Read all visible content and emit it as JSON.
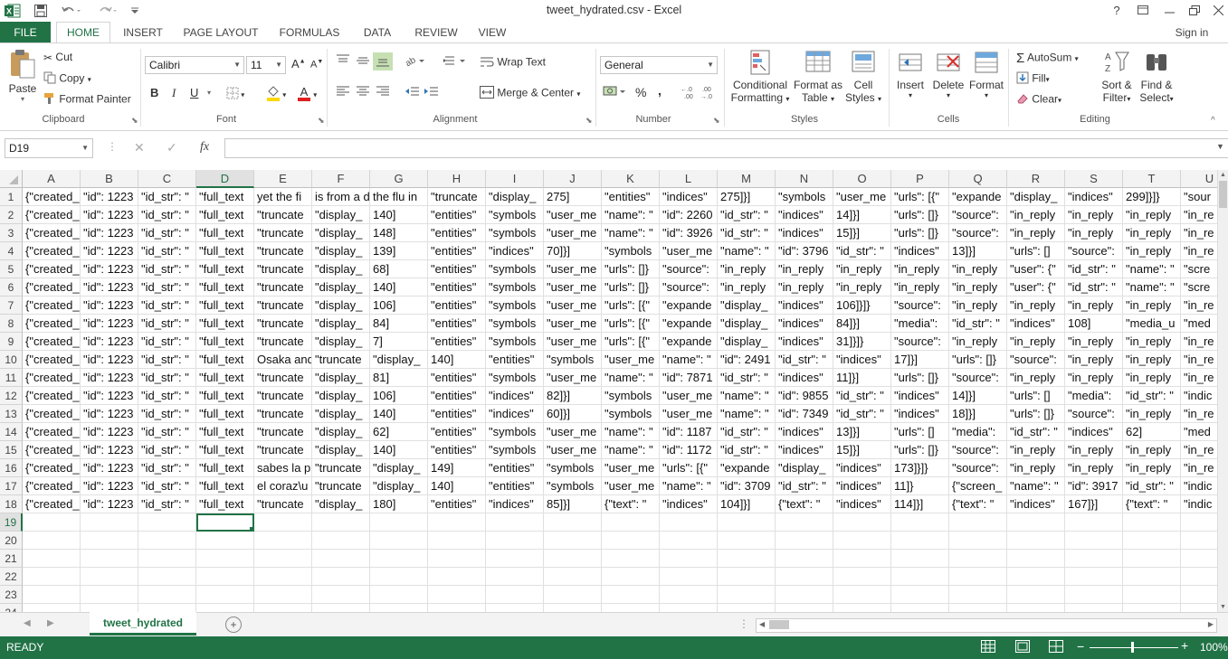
{
  "window": {
    "title": "tweet_hydrated.csv - Excel",
    "help": "?",
    "signin": "Sign in"
  },
  "tabs": [
    "FILE",
    "HOME",
    "INSERT",
    "PAGE LAYOUT",
    "FORMULAS",
    "DATA",
    "REVIEW",
    "VIEW"
  ],
  "active_tab": "HOME",
  "ribbon": {
    "clipboard": {
      "label": "Clipboard",
      "paste": "Paste",
      "cut": "Cut",
      "copy": "Copy",
      "format_painter": "Format Painter"
    },
    "font": {
      "label": "Font",
      "family": "Calibri",
      "size": "11",
      "bold": "B",
      "italic": "I",
      "underline": "U",
      "grow": "A",
      "shrink": "A"
    },
    "alignment": {
      "label": "Alignment",
      "wrap": "Wrap Text",
      "merge": "Merge & Center"
    },
    "number": {
      "label": "Number",
      "format": "General",
      "percent": "%",
      "comma": ","
    },
    "styles": {
      "label": "Styles",
      "conditional": [
        "Conditional",
        "Formatting"
      ],
      "format_table": [
        "Format as",
        "Table"
      ],
      "cell_styles": [
        "Cell",
        "Styles"
      ]
    },
    "cells": {
      "label": "Cells",
      "insert": "Insert",
      "delete": "Delete",
      "format": "Format"
    },
    "editing": {
      "label": "Editing",
      "autosum": "AutoSum",
      "fill": "Fill",
      "clear": "Clear",
      "sort": [
        "Sort &",
        "Filter"
      ],
      "find": [
        "Find &",
        "Select"
      ]
    }
  },
  "formula_bar": {
    "name_box": "D19",
    "fx": "fx",
    "value": ""
  },
  "columns": [
    "A",
    "B",
    "C",
    "D",
    "E",
    "F",
    "G",
    "H",
    "I",
    "J",
    "K",
    "L",
    "M",
    "N",
    "O",
    "P",
    "Q",
    "R",
    "S",
    "T",
    "U"
  ],
  "selected_column": "D",
  "selected_row": 19,
  "row_numbers": [
    1,
    2,
    3,
    4,
    5,
    6,
    7,
    8,
    9,
    10,
    11,
    12,
    13,
    14,
    15,
    16,
    17,
    18,
    19,
    20,
    21,
    22,
    23,
    24
  ],
  "rows": [
    [
      "{\"created_",
      "\"id\": 1223",
      "\"id_str\": \"",
      "\"full_text",
      "yet the fi",
      "is from a d",
      "the flu in",
      "\"truncate",
      "\"display_",
      "275]",
      "\"entities\"",
      "\"indices\"",
      "275]}]",
      "\"symbols",
      "\"user_me",
      "\"urls\": [{\"",
      "\"expande",
      "\"display_",
      "\"indices\"",
      "299]}]}",
      "\"sour"
    ],
    [
      "{\"created_",
      "\"id\": 1223",
      "\"id_str\": \"",
      "\"full_text",
      "\"truncate",
      "\"display_",
      "140]",
      "\"entities\"",
      "\"symbols",
      "\"user_me",
      "\"name\": \"",
      "\"id\": 2260",
      "\"id_str\": \"",
      "\"indices\"",
      "14]}]",
      "\"urls\": []}",
      "\"source\":",
      "\"in_reply",
      "\"in_reply",
      "\"in_reply",
      "\"in_re"
    ],
    [
      "{\"created_",
      "\"id\": 1223",
      "\"id_str\": \"",
      "\"full_text",
      "\"truncate",
      "\"display_",
      "148]",
      "\"entities\"",
      "\"symbols",
      "\"user_me",
      "\"name\": \"",
      "\"id\": 3926",
      "\"id_str\": \"",
      "\"indices\"",
      "15]}]",
      "\"urls\": []}",
      "\"source\":",
      "\"in_reply",
      "\"in_reply",
      "\"in_reply",
      "\"in_re"
    ],
    [
      "{\"created_",
      "\"id\": 1223",
      "\"id_str\": \"",
      "\"full_text",
      "\"truncate",
      "\"display_",
      "139]",
      "\"entities\"",
      "\"indices\"",
      "70]}]",
      "\"symbols",
      "\"user_me",
      "\"name\": \"",
      "\"id\": 3796",
      "\"id_str\": \"",
      "\"indices\"",
      "13]}]",
      "\"urls\": []",
      "\"source\":",
      "\"in_reply",
      "\"in_re"
    ],
    [
      "{\"created_",
      "\"id\": 1223",
      "\"id_str\": \"",
      "\"full_text",
      "\"truncate",
      "\"display_",
      "68]",
      "\"entities\"",
      "\"symbols",
      "\"user_me",
      "\"urls\": []}",
      "\"source\":",
      "\"in_reply",
      "\"in_reply",
      "\"in_reply",
      "\"in_reply",
      "\"in_reply",
      "\"user\": {\"",
      "\"id_str\": \"",
      "\"name\": \"",
      "\"scre"
    ],
    [
      "{\"created_",
      "\"id\": 1223",
      "\"id_str\": \"",
      "\"full_text",
      "\"truncate",
      "\"display_",
      "140]",
      "\"entities\"",
      "\"symbols",
      "\"user_me",
      "\"urls\": []}",
      "\"source\":",
      "\"in_reply",
      "\"in_reply",
      "\"in_reply",
      "\"in_reply",
      "\"in_reply",
      "\"user\": {\"",
      "\"id_str\": \"",
      "\"name\": \"",
      "\"scre"
    ],
    [
      "{\"created_",
      "\"id\": 1223",
      "\"id_str\": \"",
      "\"full_text",
      "\"truncate",
      "\"display_",
      "106]",
      "\"entities\"",
      "\"symbols",
      "\"user_me",
      "\"urls\": [{\"",
      "\"expande",
      "\"display_",
      "\"indices\"",
      "106]}]}",
      "\"source\":",
      "\"in_reply",
      "\"in_reply",
      "\"in_reply",
      "\"in_reply",
      "\"in_re"
    ],
    [
      "{\"created_",
      "\"id\": 1223",
      "\"id_str\": \"",
      "\"full_text",
      "\"truncate",
      "\"display_",
      "84]",
      "\"entities\"",
      "\"symbols",
      "\"user_me",
      "\"urls\": [{\"",
      "\"expande",
      "\"display_",
      "\"indices\"",
      "84]}]",
      "\"media\":",
      "\"id_str\": \"",
      "\"indices\"",
      "108]",
      "\"media_u",
      "\"med"
    ],
    [
      "{\"created_",
      "\"id\": 1223",
      "\"id_str\": \"",
      "\"full_text",
      "\"truncate",
      "\"display_",
      "7]",
      "\"entities\"",
      "\"symbols",
      "\"user_me",
      "\"urls\": [{\"",
      "\"expande",
      "\"display_",
      "\"indices\"",
      "31]}]}",
      "\"source\":",
      "\"in_reply",
      "\"in_reply",
      "\"in_reply",
      "\"in_reply",
      "\"in_re"
    ],
    [
      "{\"created_",
      "\"id\": 1223",
      "\"id_str\": \"",
      "\"full_text",
      "Osaka and",
      "\"truncate",
      "\"display_",
      "140]",
      "\"entities\"",
      "\"symbols",
      "\"user_me",
      "\"name\": \"",
      "\"id\": 2491",
      "\"id_str\": \"",
      "\"indices\"",
      "17]}]",
      "\"urls\": []}",
      "\"source\":",
      "\"in_reply",
      "\"in_reply",
      "\"in_re"
    ],
    [
      "{\"created_",
      "\"id\": 1223",
      "\"id_str\": \"",
      "\"full_text",
      "\"truncate",
      "\"display_",
      "81]",
      "\"entities\"",
      "\"symbols",
      "\"user_me",
      "\"name\": \"",
      "\"id\": 7871",
      "\"id_str\": \"",
      "\"indices\"",
      "11]}]",
      "\"urls\": []}",
      "\"source\":",
      "\"in_reply",
      "\"in_reply",
      "\"in_reply",
      "\"in_re"
    ],
    [
      "{\"created_",
      "\"id\": 1223",
      "\"id_str\": \"",
      "\"full_text",
      "\"truncate",
      "\"display_",
      "106]",
      "\"entities\"",
      "\"indices\"",
      "82]}]",
      "\"symbols",
      "\"user_me",
      "\"name\": \"",
      "\"id\": 9855",
      "\"id_str\": \"",
      "\"indices\"",
      "14]}]",
      "\"urls\": []",
      "\"media\":",
      "\"id_str\": \"",
      "\"indic"
    ],
    [
      "{\"created_",
      "\"id\": 1223",
      "\"id_str\": \"",
      "\"full_text",
      "\"truncate",
      "\"display_",
      "140]",
      "\"entities\"",
      "\"indices\"",
      "60]}]",
      "\"symbols",
      "\"user_me",
      "\"name\": \"",
      "\"id\": 7349",
      "\"id_str\": \"",
      "\"indices\"",
      "18]}]",
      "\"urls\": []}",
      "\"source\":",
      "\"in_reply",
      "\"in_re"
    ],
    [
      "{\"created_",
      "\"id\": 1223",
      "\"id_str\": \"",
      "\"full_text",
      "\"truncate",
      "\"display_",
      "62]",
      "\"entities\"",
      "\"symbols",
      "\"user_me",
      "\"name\": \"",
      "\"id\": 1187",
      "\"id_str\": \"",
      "\"indices\"",
      "13]}]",
      "\"urls\": []",
      "\"media\":",
      "\"id_str\": \"",
      "\"indices\"",
      "62]",
      "\"med"
    ],
    [
      "{\"created_",
      "\"id\": 1223",
      "\"id_str\": \"",
      "\"full_text",
      "\"truncate",
      "\"display_",
      "140]",
      "\"entities\"",
      "\"symbols",
      "\"user_me",
      "\"name\": \"",
      "\"id\": 1172",
      "\"id_str\": \"",
      "\"indices\"",
      "15]}]",
      "\"urls\": []}",
      "\"source\":",
      "\"in_reply",
      "\"in_reply",
      "\"in_reply",
      "\"in_re"
    ],
    [
      "{\"created_",
      "\"id\": 1223",
      "\"id_str\": \"",
      "\"full_text",
      "sabes la p",
      "\"truncate",
      "\"display_",
      "149]",
      "\"entities\"",
      "\"symbols",
      "\"user_me",
      "\"urls\": [{\"",
      "\"expande",
      "\"display_",
      "\"indices\"",
      "173]}]}",
      "\"source\":",
      "\"in_reply",
      "\"in_reply",
      "\"in_reply",
      "\"in_re"
    ],
    [
      "{\"created_",
      "\"id\": 1223",
      "\"id_str\": \"",
      "\"full_text",
      "el coraz\\u",
      "\"truncate",
      "\"display_",
      "140]",
      "\"entities\"",
      "\"symbols",
      "\"user_me",
      "\"name\": \"",
      "\"id\": 3709",
      "\"id_str\": \"",
      "\"indices\"",
      "11]}",
      "{\"screen_",
      "\"name\": \"",
      "\"id\": 3917",
      "\"id_str\": \"",
      "\"indic"
    ],
    [
      "{\"created_",
      "\"id\": 1223",
      "\"id_str\": \"",
      "\"full_text",
      "\"truncate",
      "\"display_",
      "180]",
      "\"entities\"",
      "\"indices\"",
      "85]}]",
      "{\"text\": \"",
      "\"indices\"",
      "104]}]",
      "{\"text\": \"",
      "\"indices\"",
      "114]}]",
      "{\"text\": \"",
      "\"indices\"",
      "167]}]",
      "{\"text\": \"",
      "\"indic"
    ]
  ],
  "sheet": {
    "name": "tweet_hydrated",
    "add": "+"
  },
  "status": {
    "left": "READY",
    "zoom": "100%"
  }
}
